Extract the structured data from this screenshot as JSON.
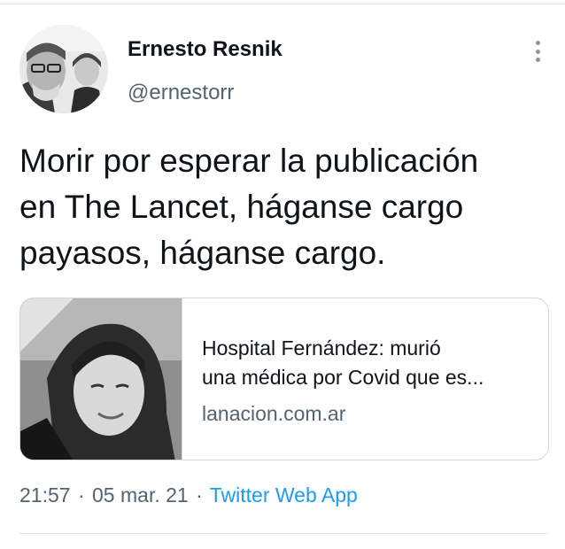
{
  "author": {
    "display_name": "Ernesto Resnik",
    "handle": "@ernestorr",
    "avatar_icon": "profile-photo"
  },
  "tweet": {
    "text_lines": [
      "Morir por esperar la publicación",
      "en The Lancet, háganse cargo",
      "payasos, háganse cargo."
    ]
  },
  "link_card": {
    "image_icon": "article-photo",
    "title_lines": [
      "Hospital Fernández: murió",
      "una médica por Covid que es..."
    ],
    "domain": "lanacion.com.ar"
  },
  "meta": {
    "time": "21:57",
    "separator": "·",
    "date": "05 mar. 21",
    "source": "Twitter Web App"
  },
  "menu": {
    "icon": "more-vertical-icon"
  },
  "colors": {
    "text": "#0f1419",
    "secondary": "#536471",
    "link": "#1d9bf0",
    "border": "#cfd9de"
  }
}
